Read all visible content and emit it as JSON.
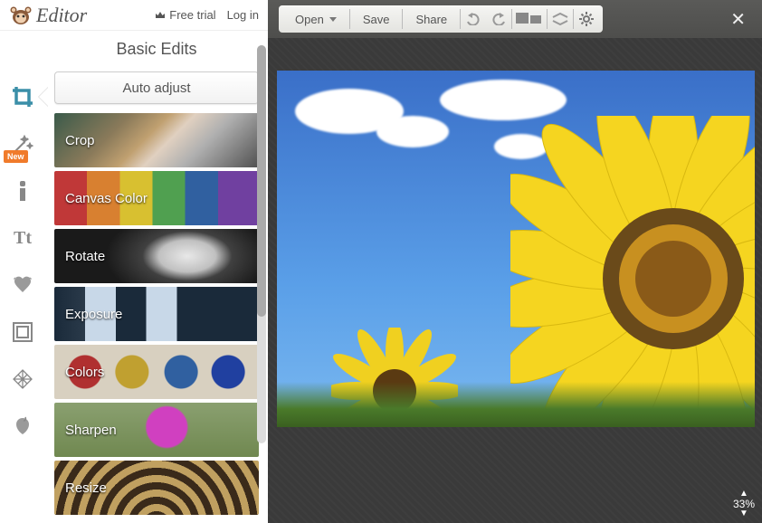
{
  "header": {
    "app_name": "Editor",
    "free_trial": "Free trial",
    "login": "Log in"
  },
  "sidebar": {
    "icons": [
      "crop-tool",
      "effects-tool",
      "touchup-tool",
      "text-tool",
      "overlays-tool",
      "frames-tool",
      "textures-tool",
      "themes-tool"
    ],
    "new_badge": "New"
  },
  "panel": {
    "title": "Basic Edits",
    "auto_adjust": "Auto adjust",
    "edits": [
      {
        "label": "Crop"
      },
      {
        "label": "Canvas Color"
      },
      {
        "label": "Rotate"
      },
      {
        "label": "Exposure"
      },
      {
        "label": "Colors"
      },
      {
        "label": "Sharpen"
      },
      {
        "label": "Resize"
      }
    ]
  },
  "toolbar": {
    "open": "Open",
    "save": "Save",
    "share": "Share"
  },
  "canvas": {
    "zoom": "33%"
  }
}
